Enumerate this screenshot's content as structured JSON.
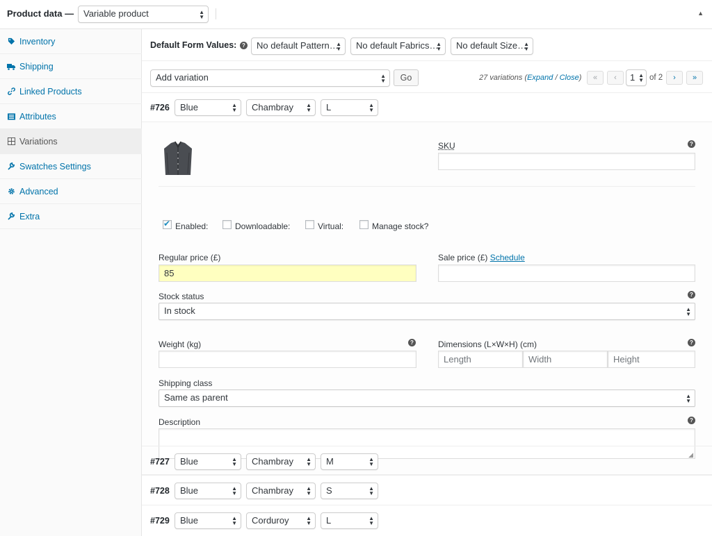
{
  "header": {
    "title": "Product data —",
    "product_type": "Variable product"
  },
  "sidebar": {
    "items": [
      {
        "label": "Inventory",
        "icon": "tag-icon"
      },
      {
        "label": "Shipping",
        "icon": "truck-icon"
      },
      {
        "label": "Linked Products",
        "icon": "link-icon"
      },
      {
        "label": "Attributes",
        "icon": "list-icon"
      },
      {
        "label": "Variations",
        "icon": "grid-icon"
      },
      {
        "label": "Swatches Settings",
        "icon": "wrench-icon"
      },
      {
        "label": "Advanced",
        "icon": "gear-icon"
      },
      {
        "label": "Extra",
        "icon": "wrench-icon"
      }
    ]
  },
  "defaults": {
    "label": "Default Form Values:",
    "pattern": "No default Pattern…",
    "fabrics": "No default Fabrics…",
    "size": "No default Size…"
  },
  "toolbar": {
    "add_variation": "Add variation",
    "go": "Go",
    "count": "27 variations (",
    "expand": "Expand",
    "slash": " / ",
    "close": "Close",
    "close_paren": ")",
    "first": "«",
    "prev": "‹",
    "page": "1",
    "of": "of 2",
    "next": "›",
    "last": "»"
  },
  "variations": [
    {
      "id": "#726",
      "color": "Blue",
      "fabric": "Chambray",
      "size": "L"
    },
    {
      "id": "#727",
      "color": "Blue",
      "fabric": "Chambray",
      "size": "M"
    },
    {
      "id": "#728",
      "color": "Blue",
      "fabric": "Chambray",
      "size": "S"
    },
    {
      "id": "#729",
      "color": "Blue",
      "fabric": "Corduroy",
      "size": "L"
    }
  ],
  "detail": {
    "sku_label": "SKU",
    "enabled": "Enabled:",
    "downloadable": "Downloadable:",
    "virtual": "Virtual:",
    "manage_stock": "Manage stock?",
    "regular_price_label": "Regular price (£)",
    "regular_price": "85",
    "sale_price_label": "Sale price (£) ",
    "schedule": "Schedule",
    "stock_status_label": "Stock status",
    "stock_status": "In stock",
    "weight_label": "Weight (kg)",
    "dimensions_label": "Dimensions (L×W×H) (cm)",
    "length_ph": "Length",
    "width_ph": "Width",
    "height_ph": "Height",
    "shipping_class_label": "Shipping class",
    "shipping_class": "Same as parent",
    "description_label": "Description"
  },
  "colors": {
    "accent": "#0073aa",
    "price_highlight": "#ffffc0"
  }
}
